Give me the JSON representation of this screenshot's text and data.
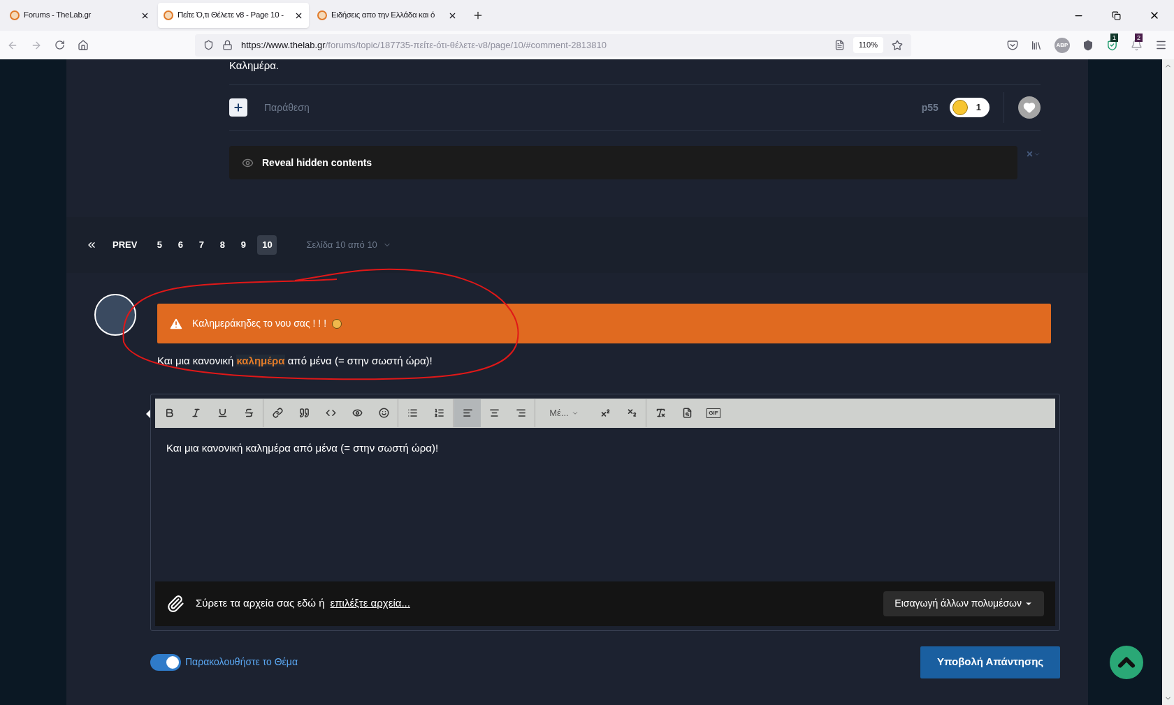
{
  "browser": {
    "tabs": [
      {
        "title": "Forums - TheLab.gr",
        "selected": false
      },
      {
        "title": "Πείτε Ό,τι Θέλετε v8 - Page 10 -",
        "selected": true
      },
      {
        "title": "Ειδήσεις απο την Ελλάδα και ό",
        "selected": false
      }
    ],
    "url_host": "https://www.thelab.gr",
    "url_path": "/forums/topic/187735-πείτε-ότι-θέλετε-v8/page/10/#comment-2813810",
    "zoom": "110%",
    "adblock_label": "ABP",
    "extension_badges": [
      "1",
      "2"
    ]
  },
  "post": {
    "top_text": "Καλημέρα.",
    "quote_label": "Παράθεση",
    "author": "p55",
    "reaction_count": "1",
    "hidden_label": "Reveal hidden contents"
  },
  "pagination": {
    "prev": "PREV",
    "pages": [
      {
        "label": "5",
        "selected": false
      },
      {
        "label": "6",
        "selected": false
      },
      {
        "label": "7",
        "selected": false
      },
      {
        "label": "8",
        "selected": false
      },
      {
        "label": "9",
        "selected": false
      },
      {
        "label": "10",
        "selected": true
      }
    ],
    "page_info": "Σελίδα 10 από 10"
  },
  "reply": {
    "warning": "Καλημεράκηδες το νου σας ! ! !",
    "body": "Και μια κανονική **καλημέρα** από μένα (= στην σωστή ώρα)!"
  },
  "editor": {
    "toolbar": [
      [
        {
          "kind": "bold",
          "selected": false
        },
        {
          "kind": "italic",
          "selected": false
        },
        {
          "kind": "underline",
          "selected": false
        },
        {
          "kind": "strike",
          "selected": false
        }
      ],
      [
        {
          "kind": "link",
          "selected": false
        },
        {
          "kind": "quote",
          "selected": false
        },
        {
          "kind": "code",
          "selected": false
        },
        {
          "kind": "spoiler",
          "selected": false
        },
        {
          "kind": "emoji",
          "selected": false
        }
      ],
      [
        {
          "kind": "bullets",
          "selected": false
        },
        {
          "kind": "numbers",
          "selected": false
        }
      ],
      [
        {
          "kind": "align-left",
          "selected": true
        },
        {
          "kind": "align-center",
          "selected": false
        },
        {
          "kind": "align-right",
          "selected": false
        }
      ],
      [
        {
          "kind": "size",
          "label": "Μέ...",
          "selected": false
        },
        {
          "kind": "superscript",
          "selected": false
        },
        {
          "kind": "subscript",
          "selected": false
        }
      ],
      [
        {
          "kind": "clear",
          "selected": false
        },
        {
          "kind": "preview",
          "selected": false
        },
        {
          "kind": "gif",
          "label": "GIF",
          "selected": false
        }
      ]
    ],
    "text": "Και μια κανονική καλημέρα από μένα (= στην σωστή ώρα)!",
    "attach_text": "Σύρετε τα αρχεία σας εδώ ή",
    "attach_link": "επιλέξτε αρχεία...",
    "media_button": "Εισαγωγή άλλων πολυμέσων"
  },
  "follow": {
    "label": "Παρακολουθήστε το Θέμα",
    "on": true
  },
  "submit": "Υποβολή Απάντησης"
}
